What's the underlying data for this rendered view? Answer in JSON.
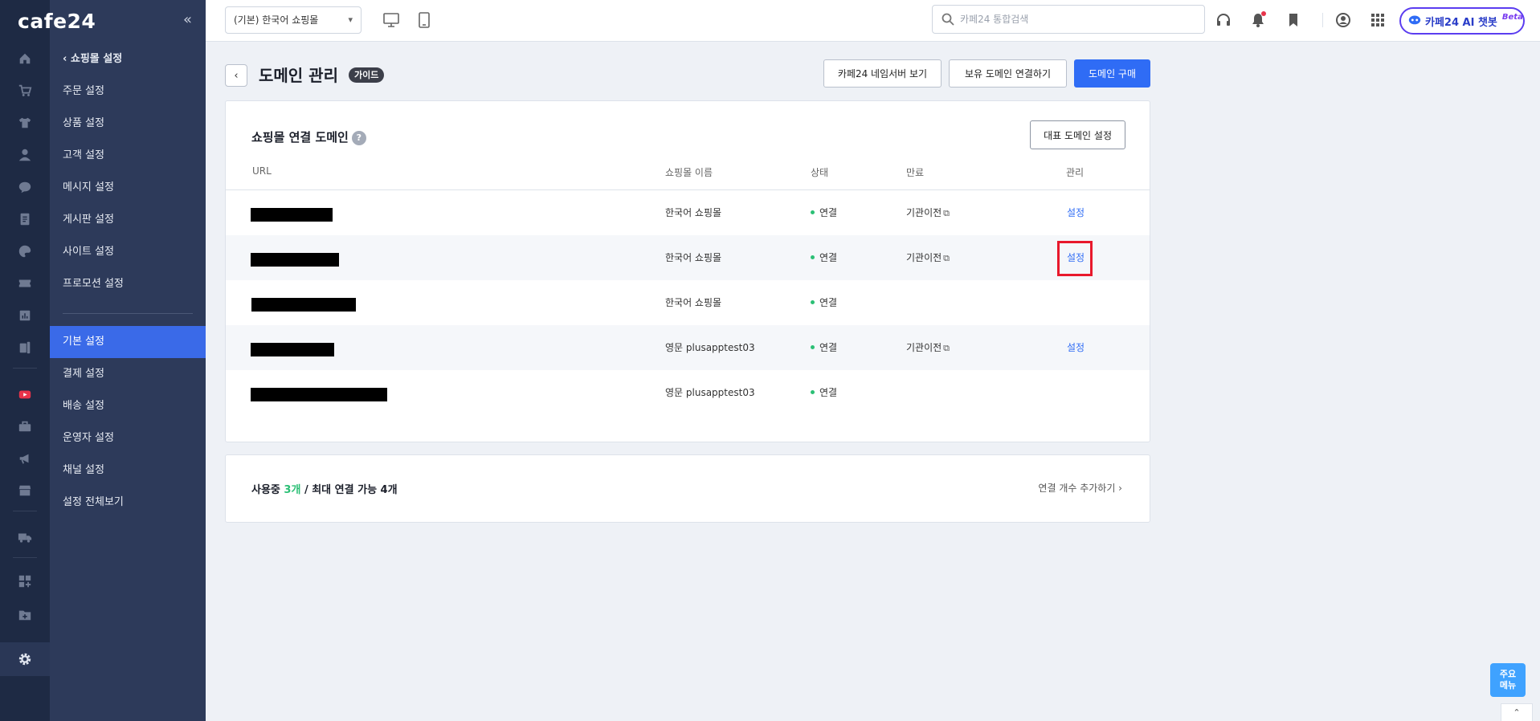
{
  "brand": {
    "logo_text": "cafe24",
    "collapse": "«"
  },
  "menu": {
    "back_label": "쇼핑몰 설정",
    "group1": [
      "주문 설정",
      "상품 설정",
      "고객 설정",
      "메시지 설정",
      "게시판 설정",
      "사이트 설정",
      "프로모션 설정"
    ],
    "group2": [
      "기본 설정",
      "결제 설정",
      "배송 설정",
      "운영자 설정",
      "채널 설정",
      "설정 전체보기"
    ],
    "active": "기본 설정"
  },
  "topbar": {
    "shop_select": "(기본) 한국어 쇼핑몰",
    "search_placeholder": "카페24 통합검색",
    "ai_label": "카페24 AI 챗봇",
    "ai_beta": "Beta"
  },
  "page": {
    "title": "도메인 관리",
    "guide": "가이드",
    "btn_nameserver": "카페24 네임서버 보기",
    "btn_connect": "보유 도메인 연결하기",
    "btn_buy": "도메인 구매"
  },
  "domains": {
    "title": "쇼핑몰 연결 도메인",
    "help": "?",
    "rep_button": "대표 도메인 설정",
    "columns": [
      "URL",
      "쇼핑몰 이름",
      "상태",
      "만료",
      "관리"
    ],
    "rows": [
      {
        "shop": "한국어 쇼핑몰",
        "status": "연결",
        "expiry": "기관이전",
        "manage": "설정"
      },
      {
        "shop": "한국어 쇼핑몰",
        "status": "연결",
        "expiry": "기관이전",
        "manage": "설정"
      },
      {
        "shop": "한국어 쇼핑몰",
        "status": "연결",
        "expiry": "",
        "manage": ""
      },
      {
        "shop": "영문 plusapptest03",
        "status": "연결",
        "expiry": "기관이전",
        "manage": "설정"
      },
      {
        "shop": "영문 plusapptest03",
        "status": "연결",
        "expiry": "",
        "manage": ""
      }
    ],
    "ext_glyph": "⧉"
  },
  "usage": {
    "prefix": "사용중 ",
    "count": "3개",
    "suffix": " / 최대 연결 가능 4개",
    "add_link": "연결 개수 추가하기 ›"
  },
  "fab": {
    "line1": "주요",
    "line2": "메뉴"
  },
  "scroll_top": "⌃"
}
